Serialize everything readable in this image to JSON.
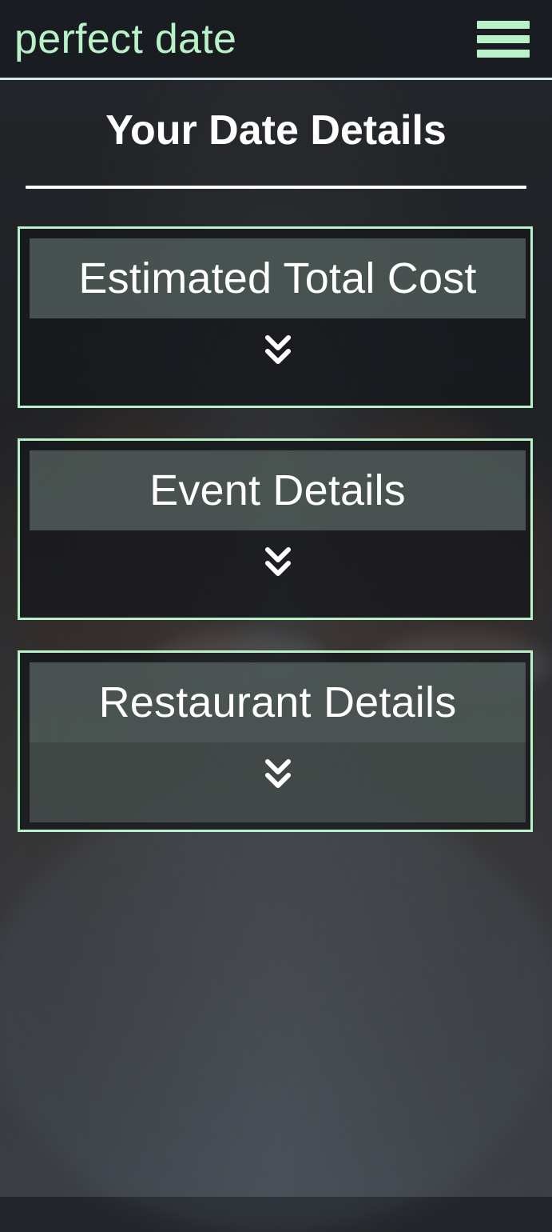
{
  "app": {
    "brand": "perfect date"
  },
  "header": {
    "menu_icon": "hamburger-menu-icon"
  },
  "main": {
    "title": "Your Date Details",
    "panels": [
      {
        "title": "Estimated Total Cost",
        "expand_icon": "double-chevron-down-icon"
      },
      {
        "title": "Event Details",
        "expand_icon": "double-chevron-down-icon"
      },
      {
        "title": "Restaurant Details",
        "expand_icon": "double-chevron-down-icon"
      }
    ]
  },
  "colors": {
    "accent": "#b9f2c8",
    "header_border": "#d8e6ee",
    "panel_header": "#5c6a65",
    "text": "#ffffff"
  }
}
